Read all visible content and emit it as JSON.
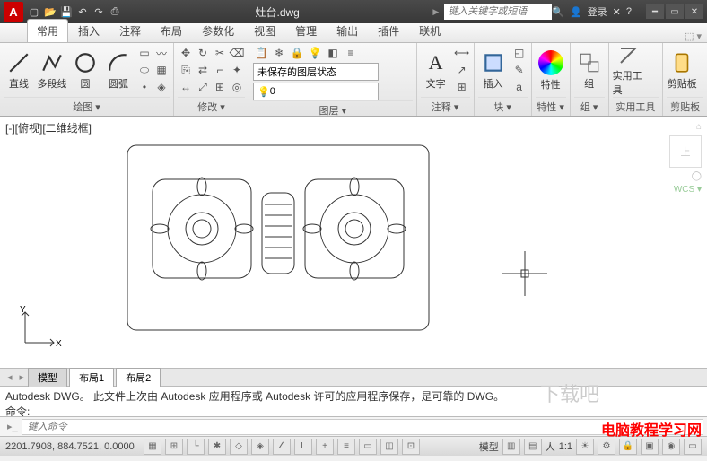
{
  "title": {
    "filename": "灶台.dwg",
    "search_placeholder": "键入关键字或短语",
    "login": "登录"
  },
  "qat": [
    "new",
    "open",
    "save",
    "undo",
    "redo",
    "print"
  ],
  "ribbon": {
    "tabs": [
      "常用",
      "插入",
      "注释",
      "布局",
      "参数化",
      "视图",
      "管理",
      "输出",
      "插件",
      "联机"
    ],
    "active": 0,
    "draw": {
      "title": "绘图 ▾",
      "line": "直线",
      "polyline": "多段线",
      "circle": "圆",
      "arc": "圆弧"
    },
    "modify": {
      "title": "修改 ▾"
    },
    "layers": {
      "title": "图层 ▾",
      "unsaved": "未保存的图层状态"
    },
    "annotation": {
      "title": "注释 ▾",
      "text": "文字"
    },
    "block": {
      "title": "块 ▾",
      "insert": "插入"
    },
    "properties": {
      "title": "特性 ▾",
      "label": "特性"
    },
    "groups": {
      "title": "组 ▾",
      "label": "组"
    },
    "utilities": {
      "title": "实用工具 ▾",
      "label": "实用工具"
    },
    "clipboard": {
      "title": "剪贴板 ▾",
      "label": "剪贴板"
    }
  },
  "canvas": {
    "view_label": "[-][俯视][二维线框]",
    "wcs": "WCS ▾",
    "axis_x": "X",
    "axis_y": "Y",
    "cube": "上"
  },
  "tabs": {
    "model": "模型",
    "layout1": "布局1",
    "layout2": "布局2"
  },
  "command": {
    "history_line1": "Autodesk DWG。 此文件上次由 Autodesk 应用程序或 Autodesk 许可的应用程序保存，是可靠的 DWG。",
    "history_line2": "命令:",
    "placeholder": "键入命令"
  },
  "status": {
    "coords": "2201.7908, 884.7521, 0.0000",
    "model": "模型",
    "scale": "1:1"
  },
  "watermark1": "电脑教程学习网",
  "watermark2": "下载吧"
}
